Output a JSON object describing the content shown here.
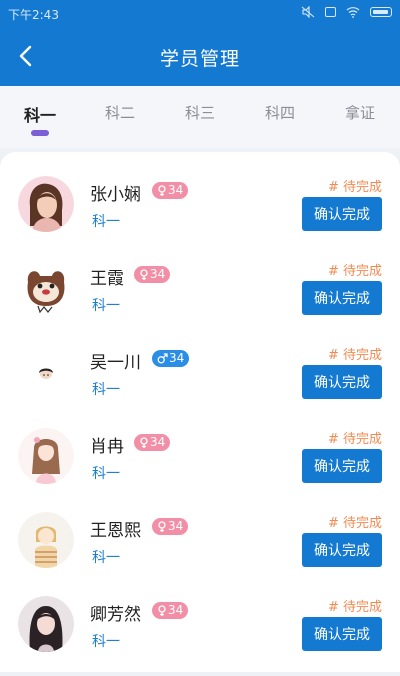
{
  "status_bar": {
    "time": "下午2:43"
  },
  "header": {
    "title": "学员管理"
  },
  "tabs": [
    {
      "label": "科一",
      "active": true
    },
    {
      "label": "科二",
      "active": false
    },
    {
      "label": "科三",
      "active": false
    },
    {
      "label": "科四",
      "active": false
    },
    {
      "label": "拿证",
      "active": false
    }
  ],
  "students": [
    {
      "name": "张小娴",
      "gender": "female",
      "age": "34",
      "subject": "科一",
      "status": "# 待完成",
      "action": "确认完成"
    },
    {
      "name": "王霞",
      "gender": "female",
      "age": "34",
      "subject": "科一",
      "status": "# 待完成",
      "action": "确认完成"
    },
    {
      "name": "吴一川",
      "gender": "male",
      "age": "34",
      "subject": "科一",
      "status": "# 待完成",
      "action": "确认完成"
    },
    {
      "name": "肖冉",
      "gender": "female",
      "age": "34",
      "subject": "科一",
      "status": "# 待完成",
      "action": "确认完成"
    },
    {
      "name": "王恩熙",
      "gender": "female",
      "age": "34",
      "subject": "科一",
      "status": "# 待完成",
      "action": "确认完成"
    },
    {
      "name": "卿芳然",
      "gender": "female",
      "age": "34",
      "subject": "科一",
      "status": "# 待完成",
      "action": "确认完成"
    }
  ],
  "colors": {
    "primary": "#1479d1",
    "status_pending": "#f08a52",
    "female_badge": "#f28fa6",
    "male_badge": "#2a8ee6",
    "tab_indicator": "#7b5fd6"
  },
  "icons": {
    "back": "chevron-left-icon",
    "female": "female-symbol-icon",
    "male": "male-symbol-icon"
  }
}
